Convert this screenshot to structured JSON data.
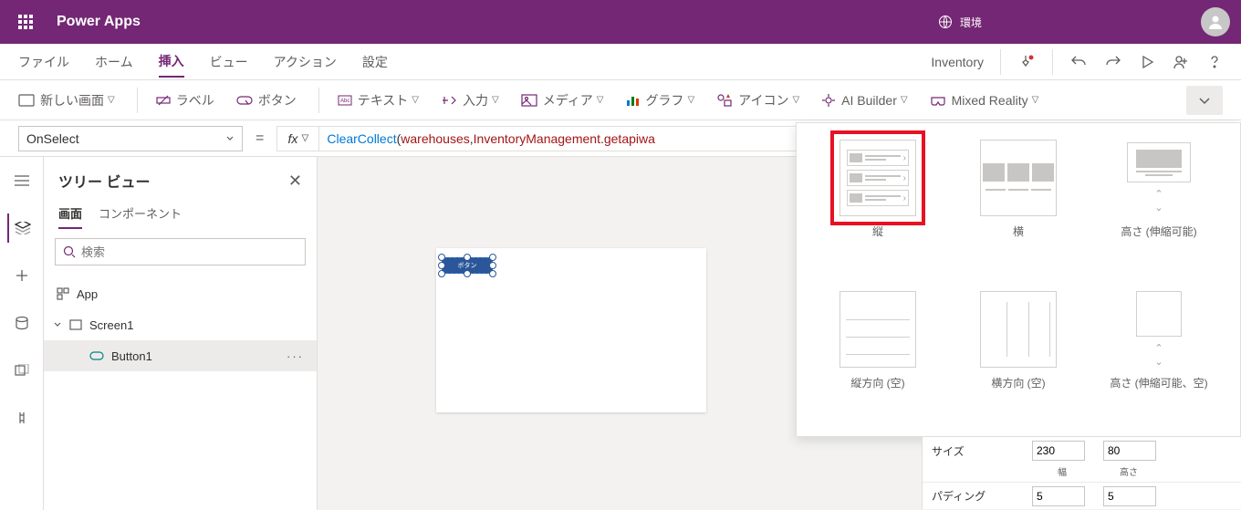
{
  "brand": "Power Apps",
  "env_label": "環境",
  "menubar": {
    "file": "ファイル",
    "home": "ホーム",
    "insert": "挿入",
    "view": "ビュー",
    "action": "アクション",
    "settings": "設定",
    "inventory": "Inventory"
  },
  "ribbon": {
    "new_screen": "新しい画面",
    "label": "ラベル",
    "button": "ボタン",
    "text": "テキスト",
    "input": "入力",
    "media": "メディア",
    "chart": "グラフ",
    "icon": "アイコン",
    "ai": "AI Builder",
    "mr": "Mixed Reality"
  },
  "formula": {
    "prop": "OnSelect",
    "fx": "fx",
    "fn": "ClearCollect",
    "args_open": "(",
    "id1": "warehouses",
    "comma": ", ",
    "id2": "InventoryManagement",
    "dot": ".",
    "id3": "getapiwa"
  },
  "tree": {
    "title": "ツリー ビュー",
    "tab_screens": "画面",
    "tab_components": "コンポーネント",
    "search_ph": "検索",
    "app": "App",
    "screen1": "Screen1",
    "button1": "Button1"
  },
  "canvas": {
    "button_text": "ボタン"
  },
  "gallery": {
    "vertical": "縦",
    "horizontal": "横",
    "flex_h": "高さ (伸縮可能)",
    "blank_v": "縦方向 (空)",
    "blank_h": "横方向 (空)",
    "blank_flex": "高さ (伸縮可能、空)"
  },
  "props": {
    "size": "サイズ",
    "width_v": "230",
    "height_v": "80",
    "width_l": "幅",
    "height_l": "高さ",
    "padding": "パディング",
    "pad_t": "5",
    "pad_b": "5"
  }
}
